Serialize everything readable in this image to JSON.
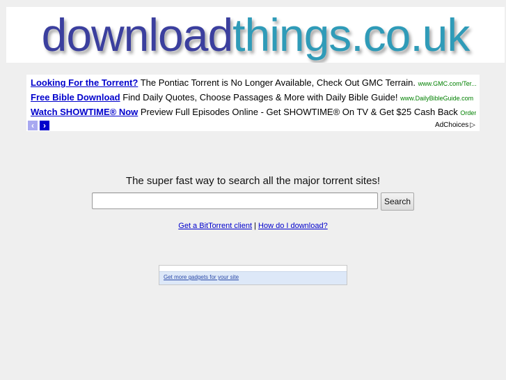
{
  "header": {
    "logo_part1": "download",
    "logo_part2": "things.co.uk",
    "colors": {
      "part1": "#3b3f9e",
      "part2": "#2f9bb8"
    }
  },
  "ads": {
    "items": [
      {
        "title": "Looking For the Torrent?",
        "description": "The Pontiac Torrent is No Longer Available, Check Out GMC Terrain.",
        "url": "www.GMC.com/Ter..."
      },
      {
        "title": "Free Bible Download",
        "description": "Find Daily Quotes, Choose Passages & More with Daily Bible Guide!",
        "url": "www.DailyBibleGuide.com"
      },
      {
        "title": "Watch SHOWTIME® Now",
        "description": "Preview Full Episodes Online - Get SHOWTIME® On TV & Get $25 Cash Back",
        "url": "OrderS..."
      }
    ],
    "prev_icon": "‹",
    "next_icon": "›",
    "adchoices_label": "AdChoices",
    "adchoices_icon": "▷"
  },
  "search": {
    "tagline": "The super fast way to search all the major torrent sites!",
    "input_value": "",
    "input_placeholder": "",
    "button_label": "Search"
  },
  "links": {
    "bittorrent": "Get a BitTorrent client",
    "separator": "|",
    "how_to": "How do I download?"
  },
  "gadget": {
    "link_label": "Get more gadgets for your site"
  }
}
